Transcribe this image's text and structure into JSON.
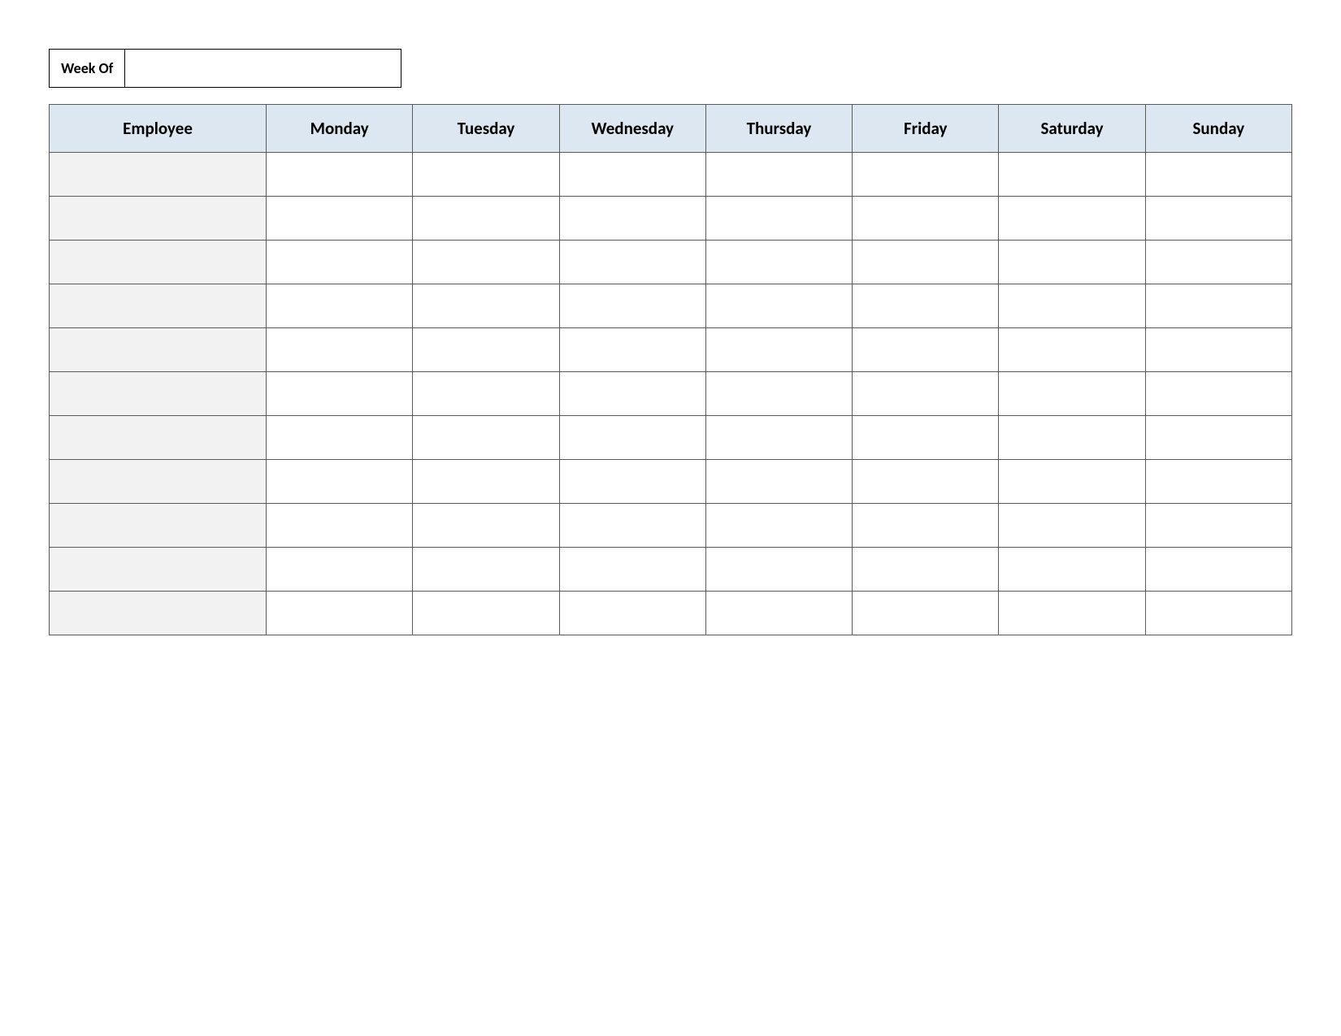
{
  "weekOf": {
    "label": "Week Of",
    "value": ""
  },
  "table": {
    "headers": [
      "Employee",
      "Monday",
      "Tuesday",
      "Wednesday",
      "Thursday",
      "Friday",
      "Saturday",
      "Sunday"
    ],
    "rows": [
      {
        "employee": "",
        "monday": "",
        "tuesday": "",
        "wednesday": "",
        "thursday": "",
        "friday": "",
        "saturday": "",
        "sunday": ""
      },
      {
        "employee": "",
        "monday": "",
        "tuesday": "",
        "wednesday": "",
        "thursday": "",
        "friday": "",
        "saturday": "",
        "sunday": ""
      },
      {
        "employee": "",
        "monday": "",
        "tuesday": "",
        "wednesday": "",
        "thursday": "",
        "friday": "",
        "saturday": "",
        "sunday": ""
      },
      {
        "employee": "",
        "monday": "",
        "tuesday": "",
        "wednesday": "",
        "thursday": "",
        "friday": "",
        "saturday": "",
        "sunday": ""
      },
      {
        "employee": "",
        "monday": "",
        "tuesday": "",
        "wednesday": "",
        "thursday": "",
        "friday": "",
        "saturday": "",
        "sunday": ""
      },
      {
        "employee": "",
        "monday": "",
        "tuesday": "",
        "wednesday": "",
        "thursday": "",
        "friday": "",
        "saturday": "",
        "sunday": ""
      },
      {
        "employee": "",
        "monday": "",
        "tuesday": "",
        "wednesday": "",
        "thursday": "",
        "friday": "",
        "saturday": "",
        "sunday": ""
      },
      {
        "employee": "",
        "monday": "",
        "tuesday": "",
        "wednesday": "",
        "thursday": "",
        "friday": "",
        "saturday": "",
        "sunday": ""
      },
      {
        "employee": "",
        "monday": "",
        "tuesday": "",
        "wednesday": "",
        "thursday": "",
        "friday": "",
        "saturday": "",
        "sunday": ""
      },
      {
        "employee": "",
        "monday": "",
        "tuesday": "",
        "wednesday": "",
        "thursday": "",
        "friday": "",
        "saturday": "",
        "sunday": ""
      },
      {
        "employee": "",
        "monday": "",
        "tuesday": "",
        "wednesday": "",
        "thursday": "",
        "friday": "",
        "saturday": "",
        "sunday": ""
      }
    ]
  }
}
